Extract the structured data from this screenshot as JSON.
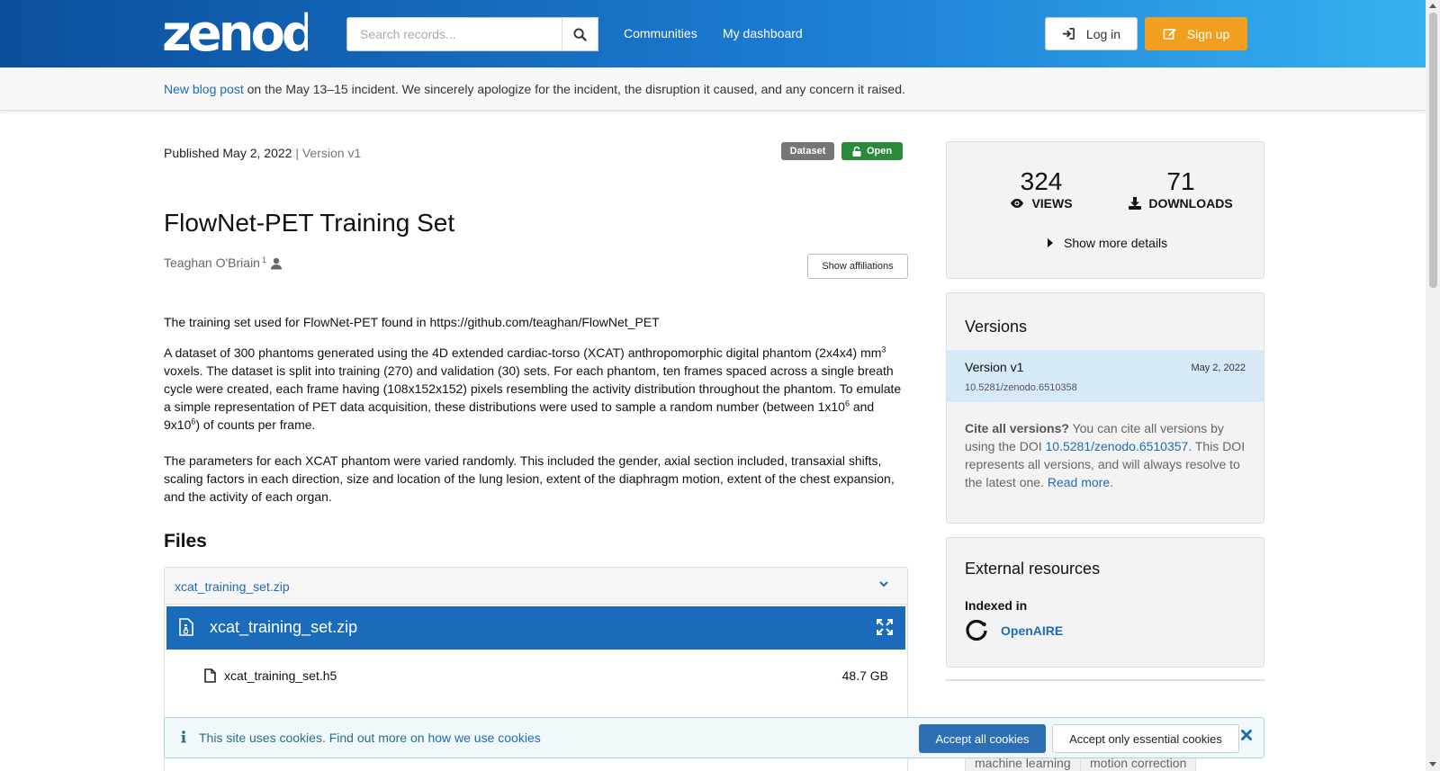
{
  "header": {
    "logo_text": "zenodo",
    "search_placeholder": "Search records...",
    "nav": [
      "Communities",
      "My dashboard"
    ],
    "login_label": "Log in",
    "signup_label": "Sign up"
  },
  "banner": {
    "link_text": "New blog post",
    "text": " on the May 13–15 incident. We sincerely apologize for the incident, the disruption it caused, and any concern it raised."
  },
  "record": {
    "published": "Published May 2, 2022",
    "version_sep": " | ",
    "version": "Version v1",
    "badges": {
      "type": "Dataset",
      "access": "Open"
    },
    "title": "FlowNet-PET Training Set",
    "author": "Teaghan O'Briain",
    "author_affil": "1",
    "show_affiliations": "Show affiliations",
    "desc_p1": "The training set used for FlowNet-PET found in https://github.com/teaghan/FlowNet_PET",
    "desc_p2": {
      "a": "A dataset of 300 phantoms generated using the 4D extended cardiac-torso (XCAT) anthropomorphic digital phantom (2x4x4) mm",
      "sup1": "3",
      "b": " voxels. The dataset is split into training (270) and validation (30) sets. For each phantom, ten frames spaced across a single breath cycle were created, each frame having (108x152x152) pixels resembling the activity distribution throughout the phantom. To emulate a simple representation of PET data acquisition, these distributions were used to sample a random number (between 1x10",
      "sup2": "6",
      "c": " and 9x10",
      "sup3": "6",
      "d": ") of counts per frame."
    },
    "desc_p3": "The parameters for each XCAT phantom were varied randomly. This included the gender, axial section included, transaxial shifts, scaling factors in each direction, size and location of the lung lesion, extent of the diaphragm motion, extent of the chest expansion, and the activity of each organ."
  },
  "files": {
    "heading": "Files",
    "archive_name": "xcat_training_set.zip",
    "preview_title": "xcat_training_set.zip",
    "entries": [
      {
        "name": "xcat_training_set.h5",
        "size": "48.7 GB"
      }
    ]
  },
  "stats": {
    "views": "324",
    "views_label": "VIEWS",
    "downloads": "71",
    "downloads_label": "DOWNLOADS",
    "show_more": "Show more details"
  },
  "versions": {
    "heading": "Versions",
    "current": {
      "label": "Version v1",
      "date": "May 2, 2022",
      "doi": "10.5281/zenodo.6510358"
    },
    "cite_bold": "Cite all versions?",
    "cite_text_a": " You can cite all versions by using the DOI ",
    "cite_doi": "10.5281/zenodo.6510357",
    "cite_text_b": ". This DOI represents all versions, and will always resolve to the latest one. ",
    "read_more": "Read more."
  },
  "external": {
    "heading": "External resources",
    "indexed_in": "Indexed in",
    "openaire": "OpenAIRE"
  },
  "keywords": [
    "machine learning",
    "motion correction"
  ],
  "cookies": {
    "text": "This site uses cookies. Find out more on ",
    "link": "how we use cookies",
    "accept_all": "Accept all cookies",
    "accept_essential": "Accept only essential cookies"
  },
  "colors": {
    "header_start": "#0b4f9c",
    "header_end": "#36b2f0",
    "signup": "#f29f1f",
    "open_badge": "#2a8a3a",
    "preview_bar": "#1a6cba",
    "link": "#1f6bb4"
  }
}
